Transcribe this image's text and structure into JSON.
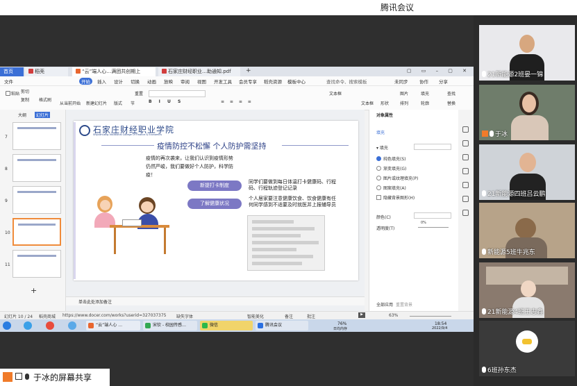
{
  "meeting_app": {
    "title": "腾讯会议"
  },
  "wps": {
    "tabs": [
      "首页",
      "稻壳",
      "“云”端人心…满团共创期上",
      "石家庄财经职业…助通知.pdf"
    ],
    "menus": [
      "文件",
      "开始",
      "插入",
      "设计",
      "切换",
      "动画",
      "放映",
      "审阅",
      "视图",
      "开发工具",
      "会员专享",
      "稻壳资源",
      "模板中心",
      "查找命令、搜索模板"
    ],
    "menu_right": [
      "未同步",
      "协作",
      "分享"
    ],
    "ribbon": {
      "row1": [
        "剪切",
        "复制",
        "格式刷",
        "当前开始",
        "新建幻灯片",
        "版式",
        "重置",
        "节",
        "文本框",
        "形状",
        "排列",
        "图片",
        "填充",
        "查找"
      ],
      "row2": [
        "粘贴",
        "从当前开始",
        "新建幻灯片",
        "版式",
        "节",
        "轮廓",
        "替换"
      ]
    },
    "thumbs_tabs": [
      "大纲",
      "幻灯片"
    ],
    "thumb_numbers": [
      "7",
      "8",
      "9",
      "10",
      "11"
    ],
    "slide": {
      "school_name": "石家庄财经职业学院",
      "school_en": "Shijiazhuang Vocational College Of Finance & Economics",
      "title": "疫情防控不松懈  个人防护需坚持",
      "intro": "疫情的再次袭来，让我们认识到疫情形势仍然严峻，我们要做好个人防护，科学防疫！",
      "pill1": "新提打卡制度",
      "pill2": "了解健康状况",
      "text1": "同学们要做到每日体温打卡健康码、行程码、行程轨迹登记记录",
      "text2": "个人居家要注意健康饮食、饮食健康有任何同学感到不适要及时就医并上报辅导员"
    },
    "notes_placeholder": "单击此处添加备注",
    "pane": {
      "title": "对象属性",
      "tab": "填充",
      "section": "填充",
      "options": [
        "纯色填充(S)",
        "渐变填充(G)",
        "图片或纹理填充(P)",
        "图案填充(A)",
        "隐藏背景图形(H)"
      ],
      "color_label": "颜色(C)",
      "transparency_label": "透明度(T)",
      "transparency_value": "0%",
      "apply_all": "全部应用",
      "reset_bg": "重置背景"
    },
    "status": {
      "slide_counter": "幻灯片 10 / 24",
      "theme": "稻壳商城",
      "url": "https://www.docer.com/works?userid=327037375",
      "missing_font": "缺失字体",
      "beautify": "智能美化",
      "notes": "备注",
      "comment": "批注",
      "zoom": "63%"
    },
    "taskbar": {
      "tasks": [
        "“云”端人心 …",
        "宋钦 - 校园传感…",
        "微信",
        "腾讯会议"
      ],
      "tray": [
        "76%",
        "日均内存",
        "18:54",
        "2022/9/4"
      ]
    }
  },
  "participants": [
    {
      "name": "21新能源2班晏一锦"
    },
    {
      "name": "于冰"
    },
    {
      "name": "21新能源四班吕云鹏"
    },
    {
      "name": "新能源5班牛兆东"
    },
    {
      "name": "21新能源4班王志鑫"
    },
    {
      "name": "6班孙东杰"
    }
  ],
  "screen_share_label": "于冰的屏幕共享",
  "colors": {
    "accent": "#3b6fd6",
    "slide_purple": "#7c78c4",
    "school_blue": "#2d4a8a"
  }
}
